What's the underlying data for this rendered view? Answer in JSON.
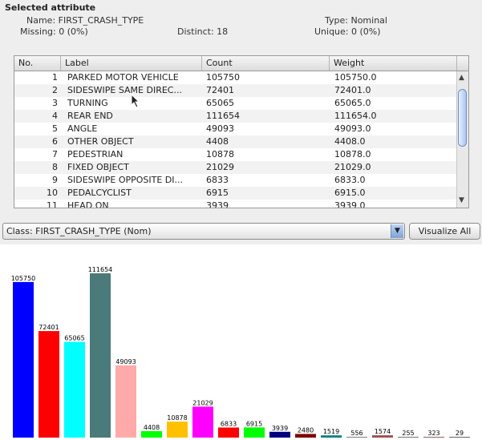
{
  "panel": {
    "title": "Selected attribute",
    "name": "Name: FIRST_CRASH_TYPE",
    "type": "Type: Nominal",
    "missing": "Missing: 0 (0%)",
    "distinct": "Distinct: 18",
    "unique": "Unique: 0 (0%)"
  },
  "table": {
    "headers": [
      "No.",
      "Label",
      "Count",
      "Weight"
    ],
    "rows": [
      {
        "no": "1",
        "label": "PARKED MOTOR VEHICLE",
        "count": "105750",
        "weight": "105750.0"
      },
      {
        "no": "2",
        "label": "SIDESWIPE SAME DIREC...",
        "count": "72401",
        "weight": "72401.0"
      },
      {
        "no": "3",
        "label": "TURNING",
        "count": "65065",
        "weight": "65065.0"
      },
      {
        "no": "4",
        "label": "REAR END",
        "count": "111654",
        "weight": "111654.0"
      },
      {
        "no": "5",
        "label": "ANGLE",
        "count": "49093",
        "weight": "49093.0"
      },
      {
        "no": "6",
        "label": "OTHER OBJECT",
        "count": "4408",
        "weight": "4408.0"
      },
      {
        "no": "7",
        "label": "PEDESTRIAN",
        "count": "10878",
        "weight": "10878.0"
      },
      {
        "no": "8",
        "label": "FIXED OBJECT",
        "count": "21029",
        "weight": "21029.0"
      },
      {
        "no": "9",
        "label": "SIDESWIPE OPPOSITE DI...",
        "count": "6833",
        "weight": "6833.0"
      },
      {
        "no": "10",
        "label": "PEDALCYCLIST",
        "count": "6915",
        "weight": "6915.0"
      },
      {
        "no": "11",
        "label": "HEAD ON",
        "count": "3939",
        "weight": "3939.0"
      }
    ],
    "scroll_up_icon": "triangle-up",
    "scroll_down_icon": "triangle-down"
  },
  "class_select": {
    "value": "Class: FIRST_CRASH_TYPE (Nom)",
    "dropdown_icon": "chevron-down"
  },
  "visualize_button": "Visualize All",
  "chart_data": {
    "type": "bar",
    "values": [
      105750,
      72401,
      65065,
      111654,
      49093,
      4408,
      10878,
      21029,
      6833,
      6915,
      3939,
      2480,
      1519,
      556,
      1574,
      255,
      323,
      29
    ],
    "colors": [
      "#0000ff",
      "#ff0000",
      "#00ffff",
      "#4a7a7a",
      "#ffaaaa",
      "#00ff00",
      "#ffc000",
      "#ff00ff",
      "#ff0000",
      "#00ff00",
      "#000080",
      "#800000",
      "#008080",
      "#808080",
      "#a05050",
      "#505050",
      "#704040",
      "#404040"
    ],
    "ylim": [
      0,
      111654
    ],
    "grid": false
  }
}
